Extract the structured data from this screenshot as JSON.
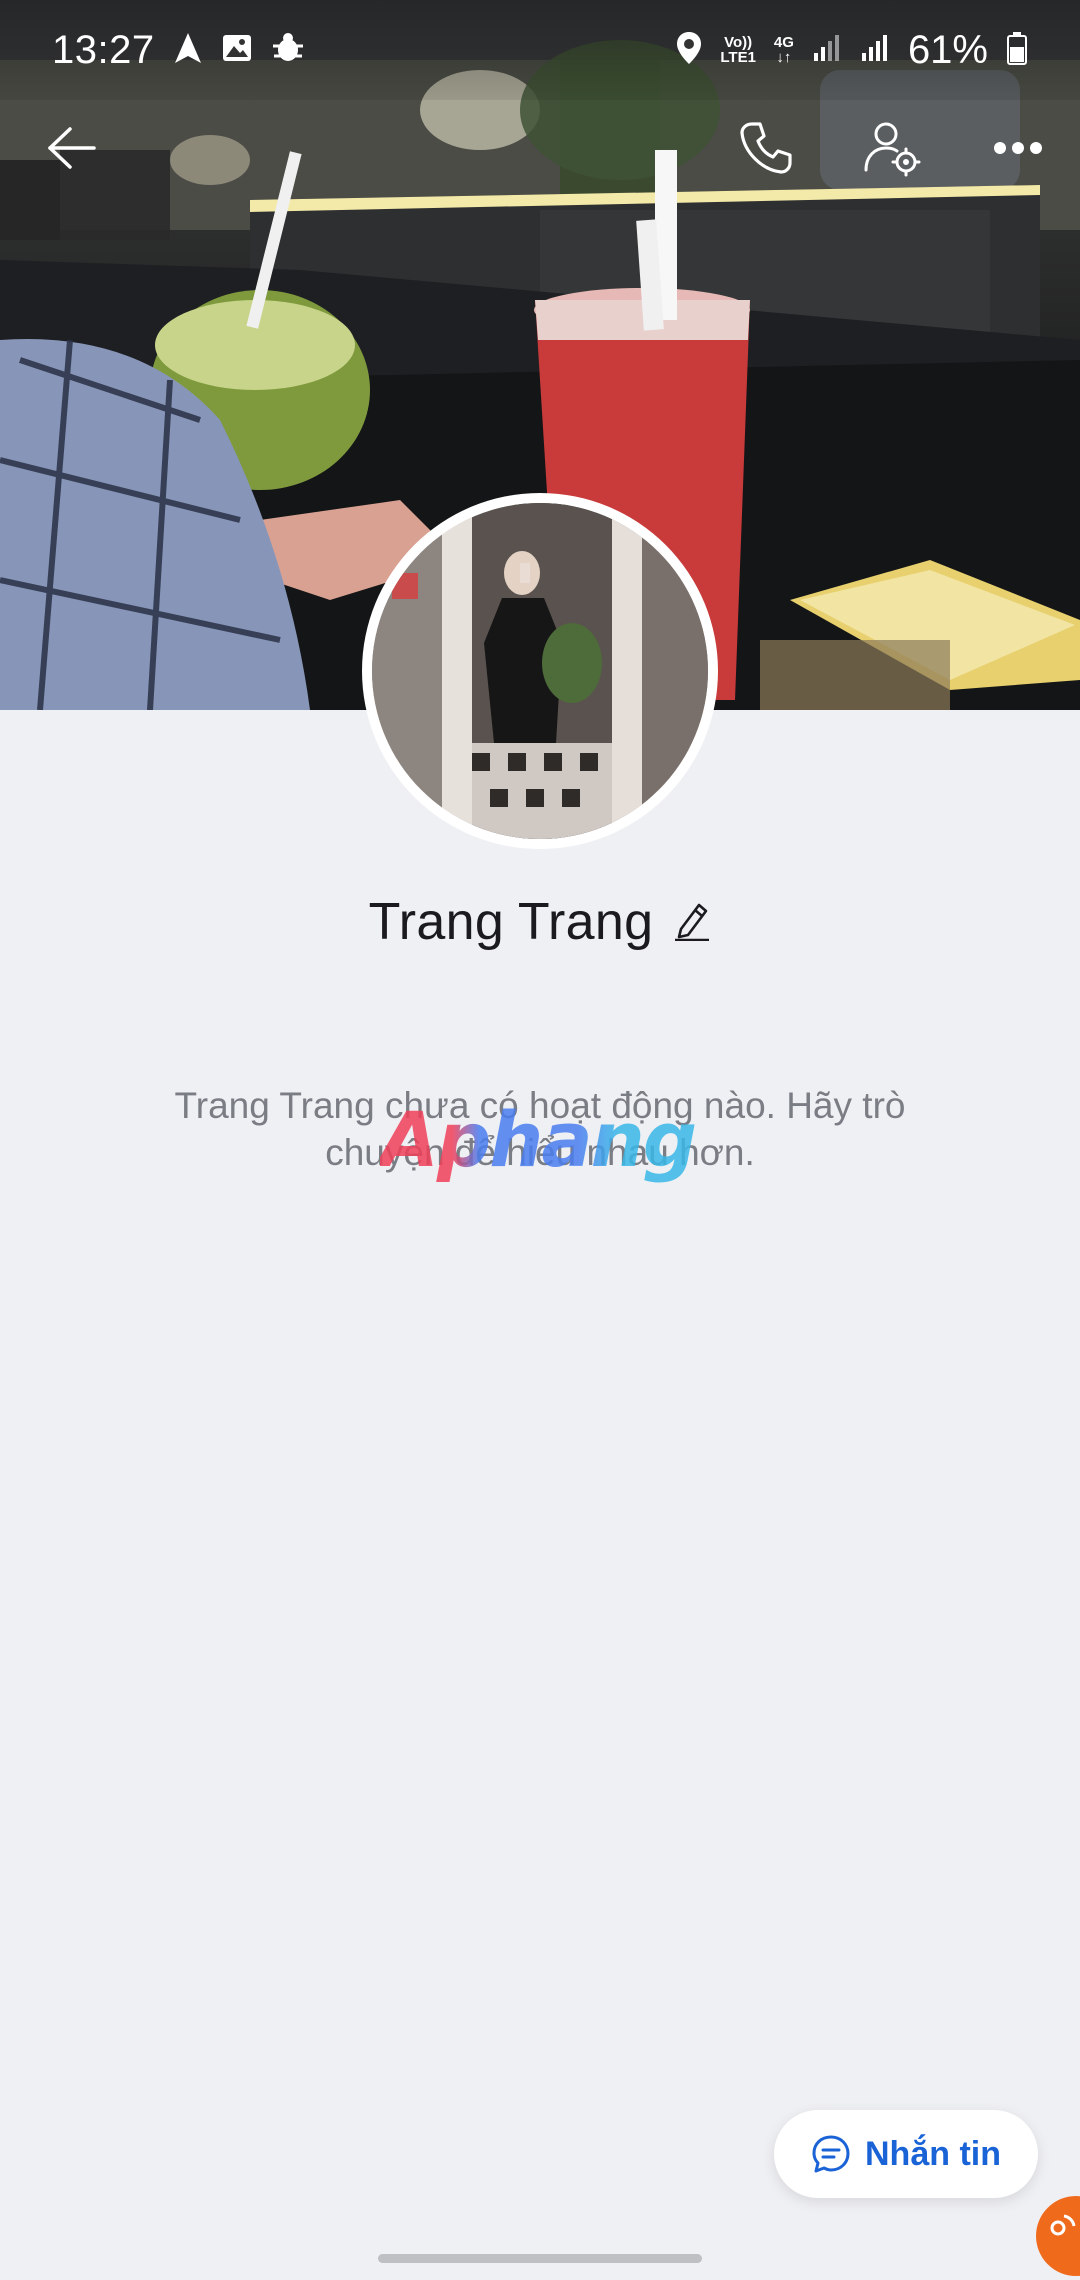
{
  "status_bar": {
    "time": "13:27",
    "network_top": "Vo))",
    "network_bottom": "LTE1",
    "network_4g": "4G",
    "battery_percent": "61%",
    "icons": [
      "navigation-arrow-icon",
      "gallery-icon",
      "bug-icon",
      "location-pin-icon",
      "volte-icon",
      "4g-data-icon",
      "signal-icon",
      "signal-icon",
      "battery-icon"
    ]
  },
  "header": {
    "back_icon": "arrow-left-icon",
    "call_icon": "phone-icon",
    "settings_icon": "user-settings-icon",
    "more_icon": "more-horizontal-icon"
  },
  "profile": {
    "name": "Trang Trang",
    "edit_icon": "pencil-icon"
  },
  "empty_state": {
    "message": "Trang Trang chưa có hoạt động nào. Hãy trò chuyện để hiểu nhau hơn."
  },
  "watermark": {
    "text": "Aphang"
  },
  "actions": {
    "message_label": "Nhắn tin",
    "message_icon": "chat-bubble-icon"
  },
  "colors": {
    "accent": "#1a63d6",
    "background": "#eff0f4",
    "badge": "#f06a1c"
  }
}
